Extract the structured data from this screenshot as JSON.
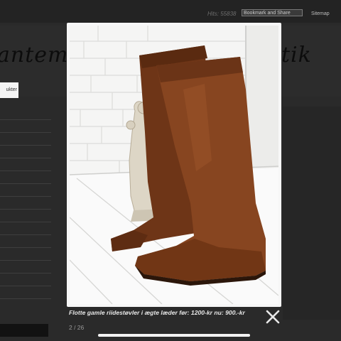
{
  "header": {
    "hits": "Hits: 55838",
    "bookmark_label": "Bookmark and Share",
    "sitemap_label": "Sitemap"
  },
  "banner": {
    "logo_left": "antemo",
    "logo_right": "tik"
  },
  "nav": {
    "tab_label": "ukter"
  },
  "lightbox": {
    "caption": "Flotte gamle riidestøvler i ægte læder før: 1200-kr nu: 900.-kr",
    "counter": "2 / 26",
    "close_icon": "close-icon"
  },
  "colors": {
    "overlay": "#1f1f1f",
    "frame": "#f7f7f7",
    "leather": "#7a3f1f"
  }
}
